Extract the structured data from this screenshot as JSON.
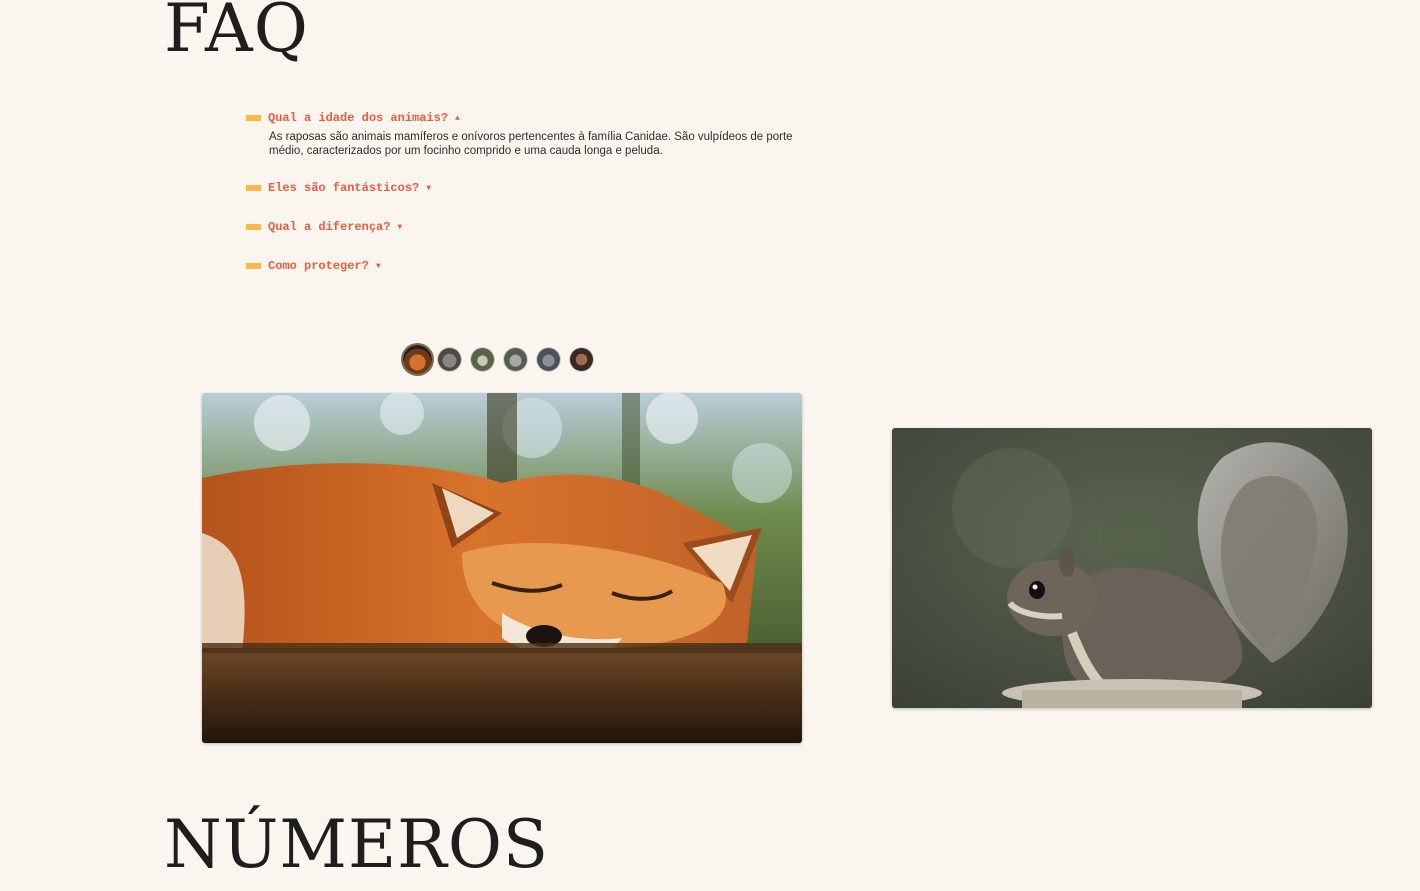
{
  "faq": {
    "title": "FAQ",
    "items": [
      {
        "question": "Qual a idade dos animais?",
        "arrow": "▲",
        "expanded": true,
        "answer": "As raposas são animais mamíferos e onívoros pertencentes à família Canidae. São vulpídeos de porte médio, caracterizados por um focinho comprido e uma cauda longa e peluda."
      },
      {
        "question": "Eles são fantásticos?",
        "arrow": "▼",
        "expanded": false
      },
      {
        "question": "Qual a diferença?",
        "arrow": "▼",
        "expanded": false
      },
      {
        "question": "Como proteger?",
        "arrow": "▼",
        "expanded": false
      }
    ]
  },
  "carousel": {
    "thumbnails": [
      {
        "subject": "fox",
        "active": true
      },
      {
        "subject": "animal-2",
        "active": false
      },
      {
        "subject": "animal-3",
        "active": false
      },
      {
        "subject": "animal-4",
        "active": false
      },
      {
        "subject": "animal-5",
        "active": false
      },
      {
        "subject": "animal-6",
        "active": false
      }
    ],
    "main_image": "sleeping-fox",
    "side_image": "squirrel"
  },
  "numeros": {
    "title": "NÚMEROS"
  },
  "colors": {
    "background": "#faf6ef",
    "question": "#ef5a3c",
    "accent_bar": "#f9b94a"
  }
}
